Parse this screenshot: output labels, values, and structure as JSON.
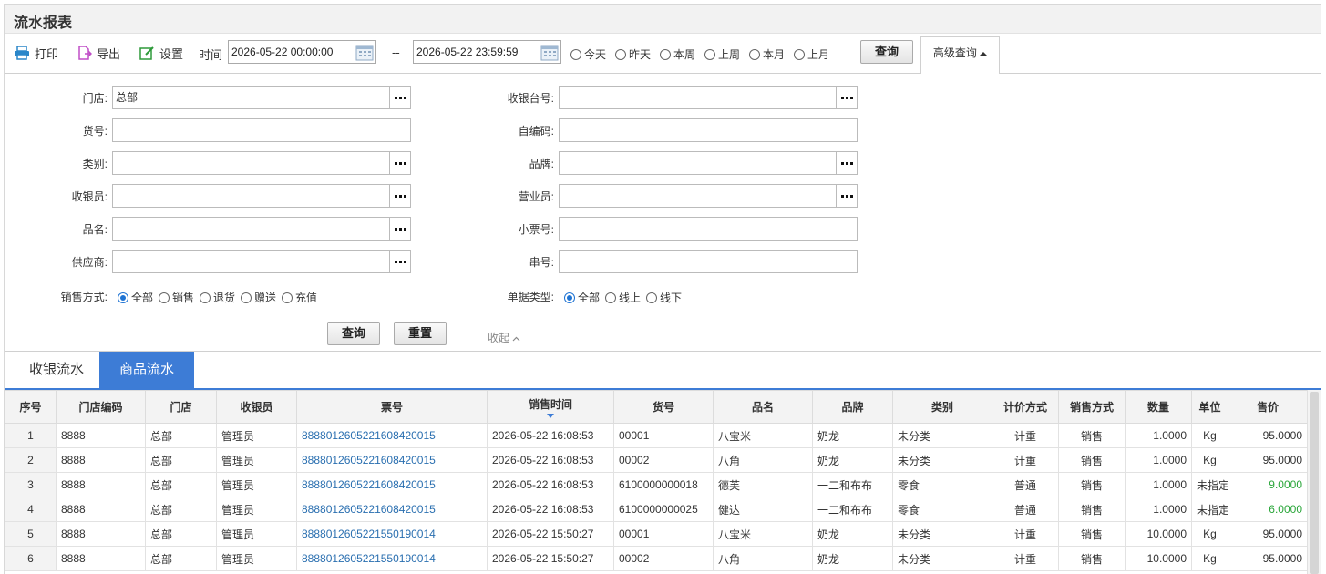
{
  "page": {
    "title": "流水报表"
  },
  "toolbar": {
    "print": "打印",
    "export": "导出",
    "settings": "设置",
    "time_label": "时间",
    "start_time": "2026-05-22 00:00:00",
    "range_sep": "--",
    "end_time": "2026-05-22 23:59:59",
    "quick_ranges": [
      "今天",
      "昨天",
      "本周",
      "上周",
      "本月",
      "上月"
    ],
    "query": "查询",
    "advanced": "高级查询"
  },
  "advanced": {
    "left_fields": [
      {
        "label": "门店:",
        "value": "总部",
        "has_picker": true
      },
      {
        "label": "货号:",
        "value": "",
        "has_picker": false
      },
      {
        "label": "类别:",
        "value": "",
        "has_picker": true
      },
      {
        "label": "收银员:",
        "value": "",
        "has_picker": true
      },
      {
        "label": "品名:",
        "value": "",
        "has_picker": true
      },
      {
        "label": "供应商:",
        "value": "",
        "has_picker": true
      }
    ],
    "right_fields": [
      {
        "label": "收银台号:",
        "value": "",
        "has_picker": true
      },
      {
        "label": "自编码:",
        "value": "",
        "has_picker": false
      },
      {
        "label": "品牌:",
        "value": "",
        "has_picker": true
      },
      {
        "label": "营业员:",
        "value": "",
        "has_picker": true
      },
      {
        "label": "小票号:",
        "value": "",
        "has_picker": false
      },
      {
        "label": "串号:",
        "value": "",
        "has_picker": false
      }
    ],
    "sale_mode_label": "销售方式:",
    "sale_modes": [
      "全部",
      "销售",
      "退货",
      "赠送",
      "充值"
    ],
    "bill_type_label": "单据类型:",
    "bill_types": [
      "全部",
      "线上",
      "线下"
    ],
    "query": "查询",
    "reset": "重置",
    "collapse": "收起"
  },
  "tabs": [
    "收银流水",
    "商品流水"
  ],
  "table": {
    "columns": [
      "序号",
      "门店编码",
      "门店",
      "收银员",
      "票号",
      "销售时间",
      "货号",
      "品名",
      "品牌",
      "类别",
      "计价方式",
      "销售方式",
      "数量",
      "单位",
      "售价"
    ],
    "rows": [
      [
        "1",
        "8888",
        "总部",
        "管理员",
        "88880126052216084200​15",
        "2026-05-22 16:08:53",
        "00001",
        "八宝米",
        "奶龙",
        "未分类",
        "计重",
        "销售",
        "1.0000",
        "Kg",
        "95.0000"
      ],
      [
        "2",
        "8888",
        "总部",
        "管理员",
        "8888012605221608420015",
        "2026-05-22 16:08:53",
        "00002",
        "八角",
        "奶龙",
        "未分类",
        "计重",
        "销售",
        "1.0000",
        "Kg",
        "95.0000"
      ],
      [
        "3",
        "8888",
        "总部",
        "管理员",
        "8888012605221608420015",
        "2026-05-22 16:08:53",
        "6100000000018",
        "德芙",
        "一二和布布",
        "零食",
        "普通",
        "销售",
        "1.0000",
        "未指定",
        "9.0000"
      ],
      [
        "4",
        "8888",
        "总部",
        "管理员",
        "8888012605221608420015",
        "2026-05-22 16:08:53",
        "6100000000025",
        "健达",
        "一二和布布",
        "零食",
        "普通",
        "销售",
        "1.0000",
        "未指定",
        "6.0000"
      ],
      [
        "5",
        "8888",
        "总部",
        "管理员",
        "8888012605221550190014",
        "2026-05-22 15:50:27",
        "00001",
        "八宝米",
        "奶龙",
        "未分类",
        "计重",
        "销售",
        "10.0000",
        "Kg",
        "95.0000"
      ],
      [
        "6",
        "8888",
        "总部",
        "管理员",
        "8888012605221550190014",
        "2026-05-22 15:50:27",
        "00002",
        "八角",
        "奶龙",
        "未分类",
        "计重",
        "销售",
        "10.0000",
        "Kg",
        "95.0000"
      ]
    ]
  },
  "colors": {
    "accent": "#3d7cd6",
    "link": "#2a6fb0",
    "green_price": "#2aa63a"
  }
}
